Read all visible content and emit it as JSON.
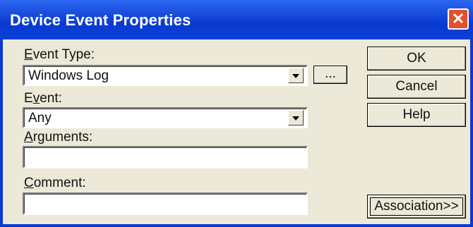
{
  "window": {
    "title": "Device Event Properties",
    "close_icon": "close-icon",
    "close_glyph": "✕"
  },
  "form": {
    "event_type_label_prefix": "",
    "event_type_label_mnemonic": "E",
    "event_type_label_rest": "vent Type:",
    "event_type_value": "Windows Log",
    "browse_label": "...",
    "event_label_prefix": "E",
    "event_label_mnemonic": "v",
    "event_label_rest": "ent:",
    "event_value": "Any",
    "arguments_label_prefix": "",
    "arguments_label_mnemonic": "A",
    "arguments_label_rest": "rguments:",
    "arguments_value": "",
    "comment_label_prefix": "",
    "comment_label_mnemonic": "C",
    "comment_label_rest": "omment:",
    "comment_value": ""
  },
  "buttons": {
    "ok": "OK",
    "cancel": "Cancel",
    "help": "Help",
    "association": "Association>>"
  },
  "colors": {
    "title_bar": "#0a3ad0",
    "face": "#ece9d8",
    "close": "#e0512c"
  }
}
